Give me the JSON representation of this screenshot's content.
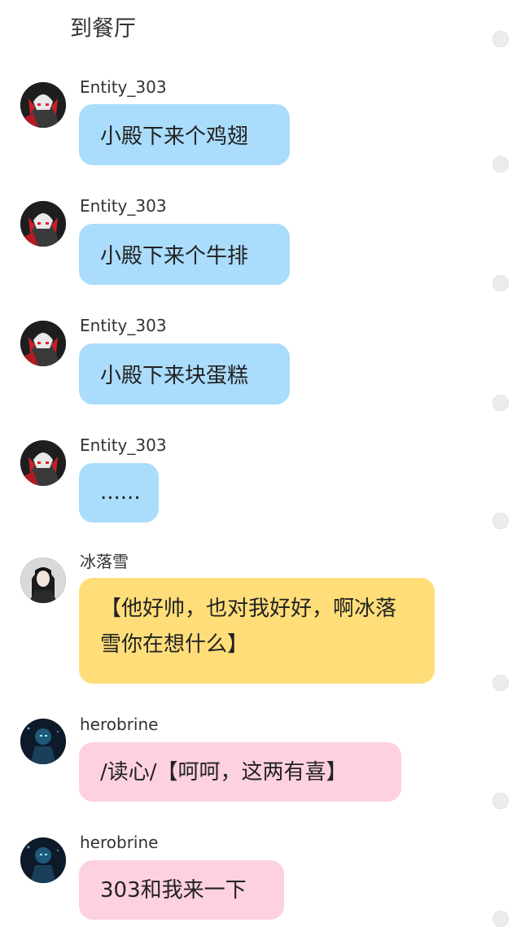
{
  "header": {
    "title": "到餐厅"
  },
  "colors": {
    "bubble_blue": "#aadcfb",
    "bubble_yellow": "#ffde7a",
    "bubble_pink": "#fdd1de",
    "select_dot": "#ececec"
  },
  "messages": [
    {
      "sender": "Entity_303",
      "avatar": "entity-303-avatar",
      "bubble_color": "blue",
      "text": "小殿下来个鸡翅"
    },
    {
      "sender": "Entity_303",
      "avatar": "entity-303-avatar",
      "bubble_color": "blue",
      "text": "小殿下来个牛排"
    },
    {
      "sender": "Entity_303",
      "avatar": "entity-303-avatar",
      "bubble_color": "blue",
      "text": "小殿下来块蛋糕"
    },
    {
      "sender": "Entity_303",
      "avatar": "entity-303-avatar",
      "bubble_color": "blue",
      "text": "......"
    },
    {
      "sender": "冰落雪",
      "avatar": "binluoxue-avatar",
      "bubble_color": "yellow",
      "text": "【他好帅，也对我好好，啊冰落雪你在想什么】"
    },
    {
      "sender": "herobrine",
      "avatar": "herobrine-avatar",
      "bubble_color": "pink",
      "text": "/读心/【呵呵，这两有喜】"
    },
    {
      "sender": "herobrine",
      "avatar": "herobrine-avatar",
      "bubble_color": "pink",
      "text": "303和我来一下"
    }
  ]
}
